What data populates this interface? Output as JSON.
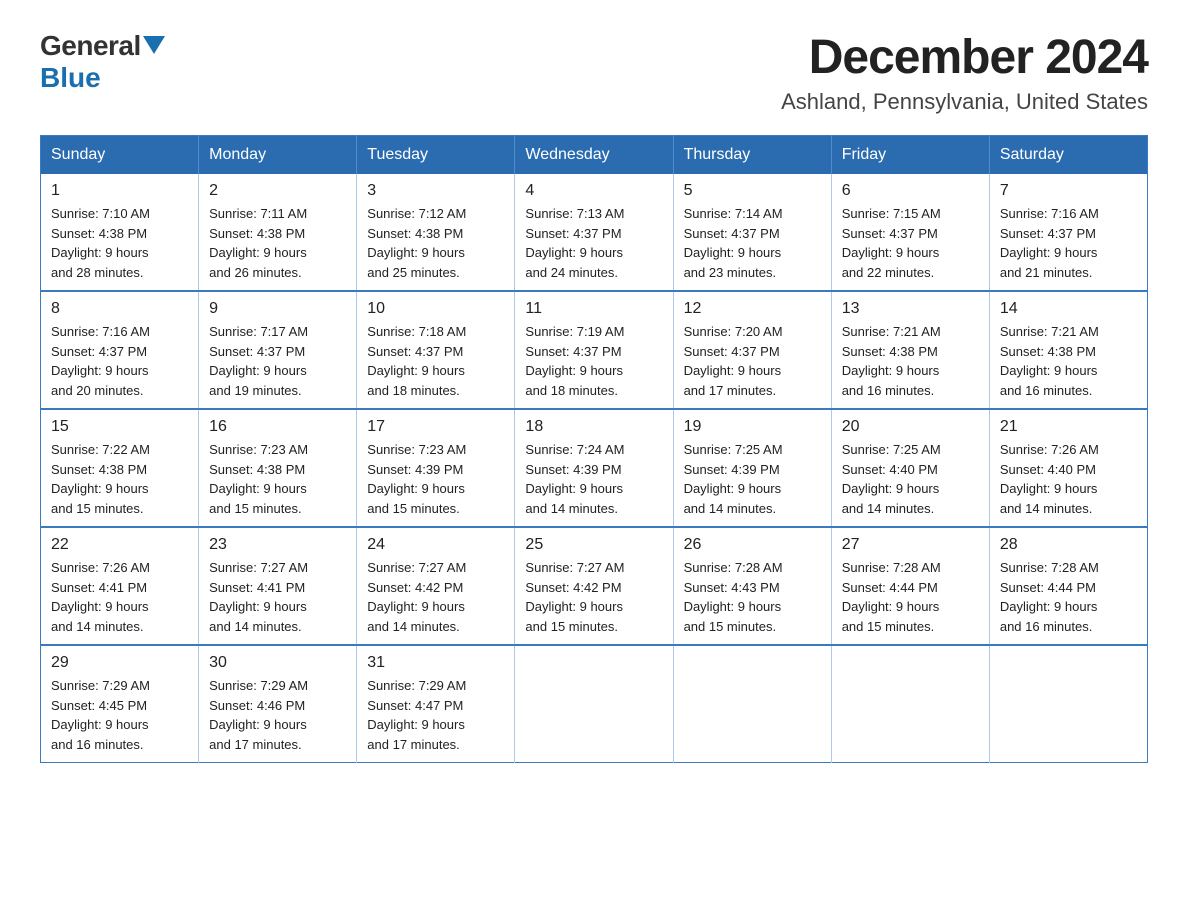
{
  "logo": {
    "general": "General",
    "blue": "Blue"
  },
  "title": "December 2024",
  "subtitle": "Ashland, Pennsylvania, United States",
  "days_of_week": [
    "Sunday",
    "Monday",
    "Tuesday",
    "Wednesday",
    "Thursday",
    "Friday",
    "Saturday"
  ],
  "weeks": [
    [
      {
        "day": "1",
        "sunrise": "7:10 AM",
        "sunset": "4:38 PM",
        "daylight": "9 hours and 28 minutes."
      },
      {
        "day": "2",
        "sunrise": "7:11 AM",
        "sunset": "4:38 PM",
        "daylight": "9 hours and 26 minutes."
      },
      {
        "day": "3",
        "sunrise": "7:12 AM",
        "sunset": "4:38 PM",
        "daylight": "9 hours and 25 minutes."
      },
      {
        "day": "4",
        "sunrise": "7:13 AM",
        "sunset": "4:37 PM",
        "daylight": "9 hours and 24 minutes."
      },
      {
        "day": "5",
        "sunrise": "7:14 AM",
        "sunset": "4:37 PM",
        "daylight": "9 hours and 23 minutes."
      },
      {
        "day": "6",
        "sunrise": "7:15 AM",
        "sunset": "4:37 PM",
        "daylight": "9 hours and 22 minutes."
      },
      {
        "day": "7",
        "sunrise": "7:16 AM",
        "sunset": "4:37 PM",
        "daylight": "9 hours and 21 minutes."
      }
    ],
    [
      {
        "day": "8",
        "sunrise": "7:16 AM",
        "sunset": "4:37 PM",
        "daylight": "9 hours and 20 minutes."
      },
      {
        "day": "9",
        "sunrise": "7:17 AM",
        "sunset": "4:37 PM",
        "daylight": "9 hours and 19 minutes."
      },
      {
        "day": "10",
        "sunrise": "7:18 AM",
        "sunset": "4:37 PM",
        "daylight": "9 hours and 18 minutes."
      },
      {
        "day": "11",
        "sunrise": "7:19 AM",
        "sunset": "4:37 PM",
        "daylight": "9 hours and 18 minutes."
      },
      {
        "day": "12",
        "sunrise": "7:20 AM",
        "sunset": "4:37 PM",
        "daylight": "9 hours and 17 minutes."
      },
      {
        "day": "13",
        "sunrise": "7:21 AM",
        "sunset": "4:38 PM",
        "daylight": "9 hours and 16 minutes."
      },
      {
        "day": "14",
        "sunrise": "7:21 AM",
        "sunset": "4:38 PM",
        "daylight": "9 hours and 16 minutes."
      }
    ],
    [
      {
        "day": "15",
        "sunrise": "7:22 AM",
        "sunset": "4:38 PM",
        "daylight": "9 hours and 15 minutes."
      },
      {
        "day": "16",
        "sunrise": "7:23 AM",
        "sunset": "4:38 PM",
        "daylight": "9 hours and 15 minutes."
      },
      {
        "day": "17",
        "sunrise": "7:23 AM",
        "sunset": "4:39 PM",
        "daylight": "9 hours and 15 minutes."
      },
      {
        "day": "18",
        "sunrise": "7:24 AM",
        "sunset": "4:39 PM",
        "daylight": "9 hours and 14 minutes."
      },
      {
        "day": "19",
        "sunrise": "7:25 AM",
        "sunset": "4:39 PM",
        "daylight": "9 hours and 14 minutes."
      },
      {
        "day": "20",
        "sunrise": "7:25 AM",
        "sunset": "4:40 PM",
        "daylight": "9 hours and 14 minutes."
      },
      {
        "day": "21",
        "sunrise": "7:26 AM",
        "sunset": "4:40 PM",
        "daylight": "9 hours and 14 minutes."
      }
    ],
    [
      {
        "day": "22",
        "sunrise": "7:26 AM",
        "sunset": "4:41 PM",
        "daylight": "9 hours and 14 minutes."
      },
      {
        "day": "23",
        "sunrise": "7:27 AM",
        "sunset": "4:41 PM",
        "daylight": "9 hours and 14 minutes."
      },
      {
        "day": "24",
        "sunrise": "7:27 AM",
        "sunset": "4:42 PM",
        "daylight": "9 hours and 14 minutes."
      },
      {
        "day": "25",
        "sunrise": "7:27 AM",
        "sunset": "4:42 PM",
        "daylight": "9 hours and 15 minutes."
      },
      {
        "day": "26",
        "sunrise": "7:28 AM",
        "sunset": "4:43 PM",
        "daylight": "9 hours and 15 minutes."
      },
      {
        "day": "27",
        "sunrise": "7:28 AM",
        "sunset": "4:44 PM",
        "daylight": "9 hours and 15 minutes."
      },
      {
        "day": "28",
        "sunrise": "7:28 AM",
        "sunset": "4:44 PM",
        "daylight": "9 hours and 16 minutes."
      }
    ],
    [
      {
        "day": "29",
        "sunrise": "7:29 AM",
        "sunset": "4:45 PM",
        "daylight": "9 hours and 16 minutes."
      },
      {
        "day": "30",
        "sunrise": "7:29 AM",
        "sunset": "4:46 PM",
        "daylight": "9 hours and 17 minutes."
      },
      {
        "day": "31",
        "sunrise": "7:29 AM",
        "sunset": "4:47 PM",
        "daylight": "9 hours and 17 minutes."
      },
      null,
      null,
      null,
      null
    ]
  ],
  "sunrise_label": "Sunrise:",
  "sunset_label": "Sunset:",
  "daylight_label": "Daylight:"
}
